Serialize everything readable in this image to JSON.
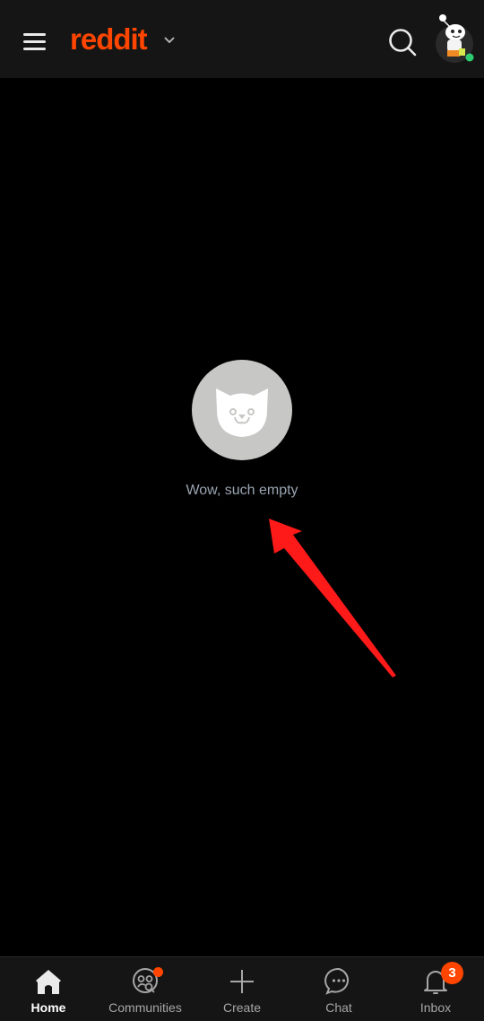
{
  "header": {
    "logo_text": "reddit",
    "menu_icon": "hamburger-menu-icon",
    "feed_switch_icon": "chevron-down-icon",
    "search_icon": "search-icon",
    "avatar_icon": "snoo-avatar",
    "online_status_color": "#2ecc71"
  },
  "main": {
    "empty_icon": "cat-face-icon",
    "empty_message": "Wow, such empty",
    "annotation": "red-arrow-pointing-to-message"
  },
  "bottom_nav": {
    "items": [
      {
        "label": "Home",
        "icon": "home-icon",
        "active": true
      },
      {
        "label": "Communities",
        "icon": "communities-icon",
        "has_dot": true
      },
      {
        "label": "Create",
        "icon": "plus-icon"
      },
      {
        "label": "Chat",
        "icon": "chat-icon"
      },
      {
        "label": "Inbox",
        "icon": "bell-icon",
        "badge": "3"
      }
    ]
  },
  "colors": {
    "brand": "#ff4500",
    "annotation_arrow": "#ff1a1a"
  }
}
